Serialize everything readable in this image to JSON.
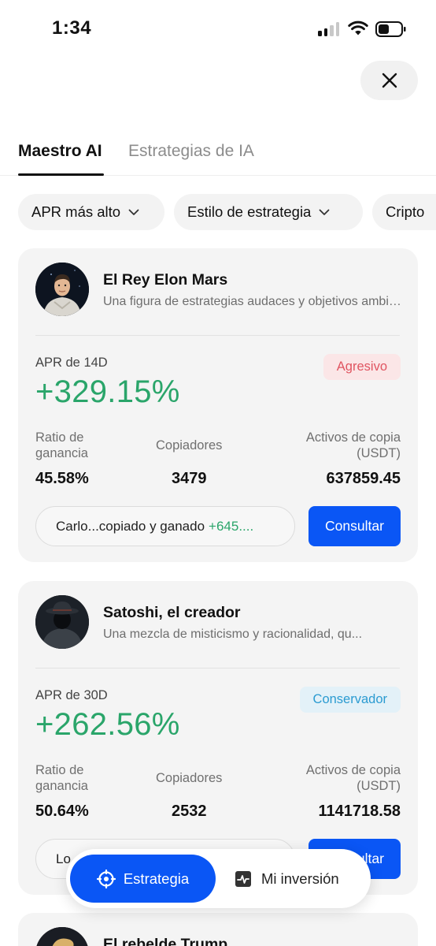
{
  "status_bar": {
    "time": "1:34"
  },
  "tabs": [
    {
      "label": "Maestro AI",
      "active": true
    },
    {
      "label": "Estrategias de IA",
      "active": false
    }
  ],
  "filters": [
    {
      "label": "APR más alto"
    },
    {
      "label": "Estilo de estrategia"
    },
    {
      "label": "Cripto"
    }
  ],
  "cards": [
    {
      "name": "El Rey Elon Mars",
      "description": "Una figura de estrategias audaces y objetivos ambiciosos",
      "apr_label": "APR de 14D",
      "apr_value": "+329.15%",
      "badge": "Agresivo",
      "ratio_label": "Ratio de ganancia",
      "ratio_value": "45.58%",
      "copiers_label": "Copiadores",
      "copiers_value": "3479",
      "assets_label": "Activos de copia (USDT)",
      "assets_value": "637859.45",
      "copied_text": "Carlo...copiado y ganado",
      "copied_gain": "+645....",
      "button": "Consultar"
    },
    {
      "name": "Satoshi, el creador",
      "description": "Una mezcla de misticismo y racionalidad, qu...",
      "apr_label": "APR de 30D",
      "apr_value": "+262.56%",
      "badge": "Conservador",
      "ratio_label": "Ratio de ganancia",
      "ratio_value": "50.64%",
      "copiers_label": "Copiadores",
      "copiers_value": "2532",
      "assets_label": "Activos de copia (USDT)",
      "assets_value": "1141718.58",
      "copied_text": "Lo",
      "copied_gain": "",
      "button": "Consultar"
    },
    {
      "name": "El rebelde Trump"
    }
  ],
  "bottom_nav": {
    "active_label": "Estrategia",
    "inactive_label": "Mi inversión"
  },
  "colors": {
    "accent": "#0a56f5",
    "positive": "#2aa56a",
    "aggressive": "#e05561",
    "conservative": "#2b9bd1"
  }
}
